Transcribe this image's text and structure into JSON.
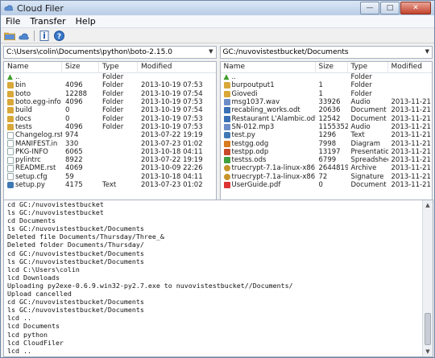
{
  "window": {
    "title": "Cloud Filer"
  },
  "menu": [
    "File",
    "Transfer",
    "Help"
  ],
  "toolbar": {
    "icons": [
      "folder-icon",
      "cloud-icon",
      "info-icon",
      "help-icon"
    ]
  },
  "columns": {
    "name": "Name",
    "size": "Size",
    "type": "Type",
    "modified": "Modified"
  },
  "left_pane": {
    "path": "C:\\Users\\colin\\Documents\\python\\boto-2.15.0",
    "rows": [
      {
        "icon": "up",
        "name": "..",
        "size": "",
        "type": "Folder",
        "modified": ""
      },
      {
        "icon": "folder",
        "name": "bin",
        "size": "4096",
        "type": "Folder",
        "modified": "2013-10-19 07:53"
      },
      {
        "icon": "folder",
        "name": "boto",
        "size": "12288",
        "type": "Folder",
        "modified": "2013-10-19 07:54"
      },
      {
        "icon": "folder",
        "name": "boto.egg-info",
        "size": "4096",
        "type": "Folder",
        "modified": "2013-10-19 07:53"
      },
      {
        "icon": "folder",
        "name": "build",
        "size": "0",
        "type": "Folder",
        "modified": "2013-10-19 07:54"
      },
      {
        "icon": "folder",
        "name": "docs",
        "size": "0",
        "type": "Folder",
        "modified": "2013-10-19 07:53"
      },
      {
        "icon": "folder",
        "name": "tests",
        "size": "4096",
        "type": "Folder",
        "modified": "2013-10-19 07:53"
      },
      {
        "icon": "file",
        "name": "Changelog.rst",
        "size": "974",
        "type": "",
        "modified": "2013-07-22 19:19"
      },
      {
        "icon": "file",
        "name": "MANIFEST.in",
        "size": "330",
        "type": "",
        "modified": "2013-07-23 01:02"
      },
      {
        "icon": "file",
        "name": "PKG-INFO",
        "size": "6065",
        "type": "",
        "modified": "2013-10-18 04:11"
      },
      {
        "icon": "file",
        "name": "pylintrc",
        "size": "8922",
        "type": "",
        "modified": "2013-07-22 19:19"
      },
      {
        "icon": "file",
        "name": "README.rst",
        "size": "4069",
        "type": "",
        "modified": "2013-10-09 22:26"
      },
      {
        "icon": "file",
        "name": "setup.cfg",
        "size": "59",
        "type": "",
        "modified": "2013-10-18 04:11"
      },
      {
        "icon": "py",
        "name": "setup.py",
        "size": "4175",
        "type": "Text",
        "modified": "2013-07-23 01:02"
      }
    ]
  },
  "right_pane": {
    "path": "GC:/nuvovistestbucket/Documents",
    "rows": [
      {
        "icon": "up",
        "name": "..",
        "size": "",
        "type": "Folder",
        "modified": ""
      },
      {
        "icon": "folder",
        "name": "burpoutput1",
        "size": "1",
        "type": "Folder",
        "modified": ""
      },
      {
        "icon": "folder",
        "name": "Giovedi",
        "size": "1",
        "type": "Folder",
        "modified": ""
      },
      {
        "icon": "audio",
        "name": "msg1037.wav",
        "size": "33926",
        "type": "Audio",
        "modified": "2013-11-21 17:32"
      },
      {
        "icon": "doc",
        "name": "recabling_works.odt",
        "size": "20636",
        "type": "Document",
        "modified": "2013-11-21 17:32"
      },
      {
        "icon": "doc",
        "name": "Restaurant L'Alambic.odt",
        "size": "12542",
        "type": "Document",
        "modified": "2013-11-21 17:31"
      },
      {
        "icon": "audio",
        "name": "SN-012.mp3",
        "size": "11553528",
        "type": "Audio",
        "modified": "2013-11-21 17:32"
      },
      {
        "icon": "py",
        "name": "test.py",
        "size": "1296",
        "type": "Text",
        "modified": "2013-11-21 17:32"
      },
      {
        "icon": "diagram",
        "name": "testgg.odg",
        "size": "7998",
        "type": "Diagram",
        "modified": "2013-11-21 17:32"
      },
      {
        "icon": "presentation",
        "name": "testpp.odp",
        "size": "13197",
        "type": "Presentation",
        "modified": "2013-11-21 17:32"
      },
      {
        "icon": "sheet",
        "name": "testss.ods",
        "size": "6799",
        "type": "Spreadsheet",
        "modified": "2013-11-21 17:32"
      },
      {
        "icon": "archive",
        "name": "truecrypt-7.1a-linux-x86.tar.gz",
        "size": "2644819",
        "type": "Archive",
        "modified": "2013-11-21 17:33"
      },
      {
        "icon": "sig",
        "name": "truecrypt-7.1a-linux-x86.tar.gz.sig",
        "size": "72",
        "type": "Signature",
        "modified": "2013-11-21 17:33"
      },
      {
        "icon": "pdf",
        "name": "UserGuide.pdf",
        "size": "0",
        "type": "Document",
        "modified": "2013-11-21 17:32"
      }
    ]
  },
  "console": [
    "cd GC:/nuvovistestbucket",
    "ls GC:/nuvovistestbucket",
    "cd Documents",
    "ls GC:/nuvovistestbucket/Documents",
    "Deleted file Documents/Thursday/Three_&",
    "Deleted folder Documents/Thursday/",
    "cd GC:/nuvovistestbucket/Documents",
    "ls GC:/nuvovistestbucket/Documents",
    "lcd C:\\Users\\colin",
    "lcd Downloads",
    "Uploading py2exe-0.6.9.win32-py2.7.exe to nuvovistestbucket//Documents/",
    "Upload cancelled",
    "cd GC:/nuvovistestbucket/Documents",
    "ls GC:/nuvovistestbucket/Documents",
    "lcd ..",
    "lcd Documents",
    "lcd python",
    "lcd CloudFiler",
    "lcd ..",
    "lcd boto-2.15.0"
  ]
}
